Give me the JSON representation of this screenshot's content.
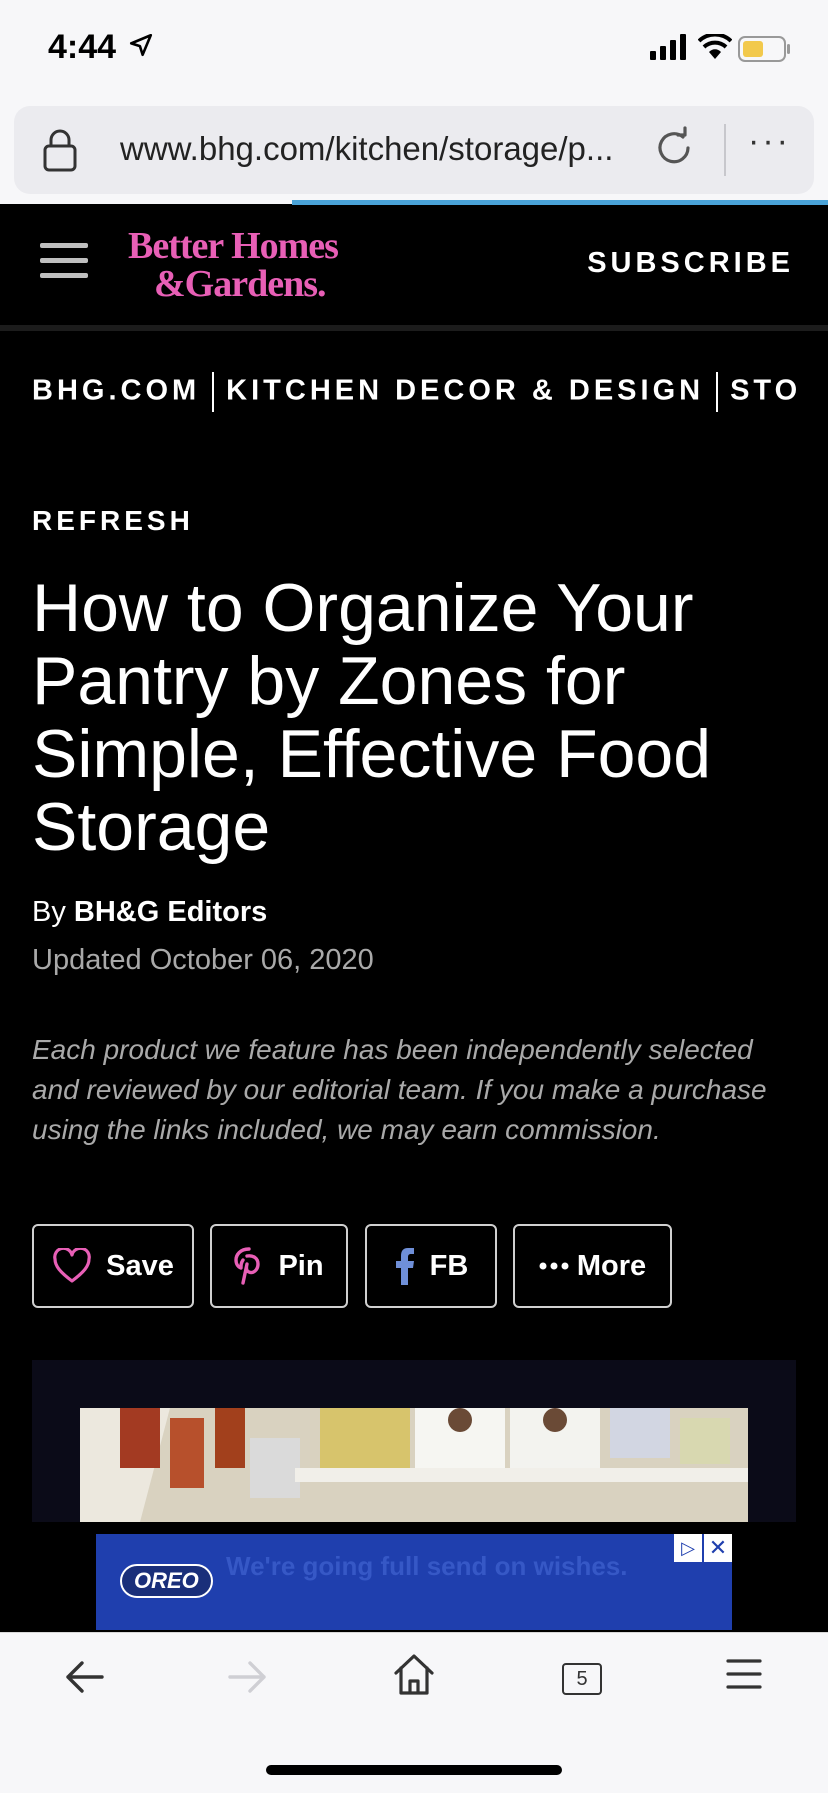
{
  "status_bar": {
    "time": "4:44"
  },
  "browser": {
    "url": "www.bhg.com/kitchen/storage/p...",
    "more_label": "···"
  },
  "site": {
    "logo_line1": "Better Homes",
    "logo_line2": "&Gardens.",
    "subscribe_label": "SUBSCRIBE",
    "brand_color": "#e85fb6"
  },
  "breadcrumb": [
    "BHG.COM",
    "KITCHEN DECOR & DESIGN",
    "STORA"
  ],
  "article": {
    "kicker": "REFRESH",
    "title": "How to Organize Your Pantry by Zones for Simple, Effective Food Storage",
    "byline_prefix": "By",
    "author": "BH&G Editors",
    "updated": "Updated October 06, 2020",
    "disclaimer": "Each product we feature has been independently selected and reviewed by our editorial team. If you make a purchase using the links included, we may earn commission."
  },
  "share": {
    "save": "Save",
    "pin": "Pin",
    "fb": "FB",
    "more": "More"
  },
  "ad": {
    "brand": "OREO",
    "text": "We're going full send on wishes."
  },
  "toolbar": {
    "tab_count": "5"
  }
}
